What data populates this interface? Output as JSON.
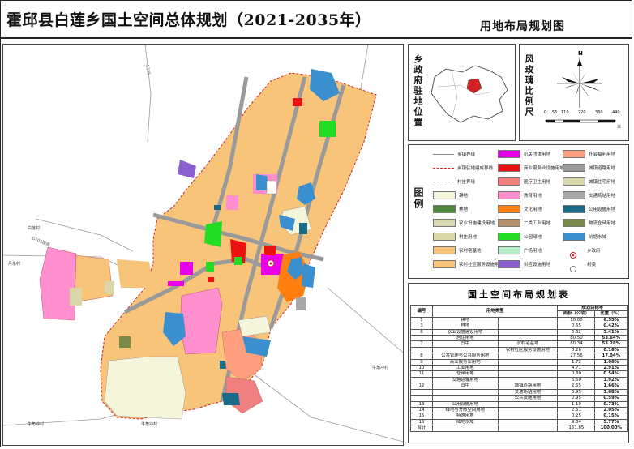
{
  "header": {
    "title": "霍邱县白莲乡国土空间总体规划（2021-2035年）",
    "subtitle": "用地布局规划图"
  },
  "map": {
    "village_labels": [
      "白莲村",
      "丹永村",
      "牛角冲村",
      "牛角冲村",
      "牛角冲村"
    ],
    "road_labels": [
      "S335",
      "G105国道"
    ]
  },
  "location_panel": {
    "label": "乡政府驻地位置"
  },
  "rose_panel": {
    "label": "风玫瑰比例尺",
    "north": "N",
    "scale_ticks": [
      "0",
      "55",
      "110",
      "220",
      "330",
      "440"
    ],
    "scale_unit": "米"
  },
  "legend": {
    "label": "图例",
    "items": [
      {
        "label": "乡镇界线",
        "color": "#8a8a8a",
        "style": "line-solid"
      },
      {
        "label": "乡镇驻地建成界线",
        "color": "#d22222",
        "style": "line-dash"
      },
      {
        "label": "村庄界线",
        "color": "#8a8a8a",
        "style": "line-dash"
      },
      {
        "label": "耕地",
        "color": "#f5f5dc",
        "style": "fill"
      },
      {
        "label": "林地",
        "color": "#4f8a3c",
        "style": "fill"
      },
      {
        "label": "农业设施建设用地",
        "color": "#d8d8b0",
        "style": "fill"
      },
      {
        "label": "村庄用地",
        "color": "#dcd7a8",
        "style": "fill"
      },
      {
        "label": "农村宅基地",
        "color": "#f8c47a",
        "style": "fill"
      },
      {
        "label": "农村社区服务设施用地",
        "color": "#f8c47a",
        "style": "fill"
      },
      {
        "label": "机关团体用地",
        "color": "#e800e8",
        "style": "fill"
      },
      {
        "label": "商业服务业设施用地",
        "color": "#ee1111",
        "style": "fill"
      },
      {
        "label": "医疗卫生用地",
        "color": "#f08080",
        "style": "fill"
      },
      {
        "label": "教育用地",
        "color": "#ff8fcf",
        "style": "fill"
      },
      {
        "label": "文化用地",
        "color": "#ff7f11",
        "style": "fill"
      },
      {
        "label": "二类工业用地",
        "color": "#b58e6a",
        "style": "fill"
      },
      {
        "label": "公园绿地",
        "color": "#22dd22",
        "style": "fill"
      },
      {
        "label": "广场用地",
        "color": "#b7f0c8",
        "style": "fill"
      },
      {
        "label": "供应设施用地",
        "color": "#8a5fd0",
        "style": "fill"
      },
      {
        "label": "社会福利用地",
        "color": "#ff9f7f",
        "style": "fill"
      },
      {
        "label": "城镇道路用地",
        "color": "#9a9a9a",
        "style": "fill"
      },
      {
        "label": "城镇住宅用地",
        "color": "#d8d8a8",
        "style": "fill"
      },
      {
        "label": "交通场站用地",
        "color": "#a8a8a8",
        "style": "fill"
      },
      {
        "label": "公用设施用地",
        "color": "#1a6a8a",
        "style": "fill"
      },
      {
        "label": "物流仓储用地",
        "color": "#7a8a4a",
        "style": "fill"
      },
      {
        "label": "坑塘水域",
        "color": "#3a8fcf",
        "style": "fill"
      },
      {
        "label": "乡政府",
        "color": "#d22222",
        "style": "symbol-gov"
      },
      {
        "label": "村委",
        "color": "#555555",
        "style": "symbol-village"
      }
    ]
  },
  "land_table": {
    "title": "国土空间布局规划表",
    "headers": [
      "编号",
      "用地类型",
      "规划目标年",
      "面积（公顷）",
      "比重（%）"
    ],
    "rows": [
      [
        "1",
        "耕地",
        "",
        "10.00",
        "6.55%"
      ],
      [
        "3",
        "林地",
        "",
        "0.65",
        "0.42%"
      ],
      [
        "6",
        "农业设施建设用地",
        "",
        "5.62",
        "3.41%"
      ],
      [
        "",
        "居住用地",
        "",
        "80.50",
        "53.64%"
      ],
      [
        "7",
        "其中",
        "农村宅基地",
        "80.34",
        "53.28%"
      ],
      [
        "",
        "",
        "农村社区服务设施用地",
        "0.26",
        "0.16%"
      ],
      [
        "8",
        "公共管理与公共服务用地",
        "",
        "27.56",
        "17.04%"
      ],
      [
        "9",
        "商业服务业用地",
        "",
        "1.72",
        "1.06%"
      ],
      [
        "10",
        "工业用地",
        "",
        "4.71",
        "2.91%"
      ],
      [
        "11",
        "仓储用地",
        "",
        "0.80",
        "0.54%"
      ],
      [
        "",
        "交通运输用地",
        "",
        "5.50",
        "3.92%"
      ],
      [
        "12",
        "其中",
        "城镇道路用地",
        "2.65",
        "1.66%"
      ],
      [
        "",
        "",
        "交通场站用地",
        "5.95",
        "3.68%"
      ],
      [
        "",
        "",
        "公共设施用地",
        "0.95",
        "0.59%"
      ],
      [
        "13",
        "公用设施用地",
        "",
        "1.19",
        "0.73%"
      ],
      [
        "14",
        "绿地与开敞空间用地",
        "",
        "2.61",
        "2.05%"
      ],
      [
        "15",
        "特殊用地",
        "",
        "0.25",
        "0.15%"
      ],
      [
        "16",
        "陆地水域",
        "",
        "9.34",
        "5.77%"
      ],
      [
        "合计",
        "",
        "",
        "161.85",
        "100.00%"
      ]
    ]
  }
}
